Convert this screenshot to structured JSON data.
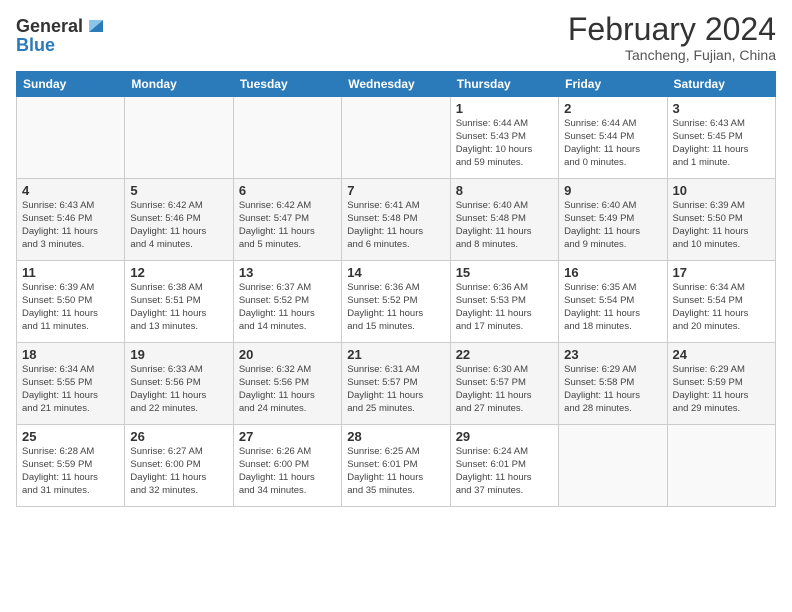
{
  "logo": {
    "general": "General",
    "blue": "Blue"
  },
  "header": {
    "title": "February 2024",
    "subtitle": "Tancheng, Fujian, China"
  },
  "weekdays": [
    "Sunday",
    "Monday",
    "Tuesday",
    "Wednesday",
    "Thursday",
    "Friday",
    "Saturday"
  ],
  "weeks": [
    [
      {
        "day": "",
        "info": ""
      },
      {
        "day": "",
        "info": ""
      },
      {
        "day": "",
        "info": ""
      },
      {
        "day": "",
        "info": ""
      },
      {
        "day": "1",
        "info": "Sunrise: 6:44 AM\nSunset: 5:43 PM\nDaylight: 10 hours\nand 59 minutes."
      },
      {
        "day": "2",
        "info": "Sunrise: 6:44 AM\nSunset: 5:44 PM\nDaylight: 11 hours\nand 0 minutes."
      },
      {
        "day": "3",
        "info": "Sunrise: 6:43 AM\nSunset: 5:45 PM\nDaylight: 11 hours\nand 1 minute."
      }
    ],
    [
      {
        "day": "4",
        "info": "Sunrise: 6:43 AM\nSunset: 5:46 PM\nDaylight: 11 hours\nand 3 minutes."
      },
      {
        "day": "5",
        "info": "Sunrise: 6:42 AM\nSunset: 5:46 PM\nDaylight: 11 hours\nand 4 minutes."
      },
      {
        "day": "6",
        "info": "Sunrise: 6:42 AM\nSunset: 5:47 PM\nDaylight: 11 hours\nand 5 minutes."
      },
      {
        "day": "7",
        "info": "Sunrise: 6:41 AM\nSunset: 5:48 PM\nDaylight: 11 hours\nand 6 minutes."
      },
      {
        "day": "8",
        "info": "Sunrise: 6:40 AM\nSunset: 5:48 PM\nDaylight: 11 hours\nand 8 minutes."
      },
      {
        "day": "9",
        "info": "Sunrise: 6:40 AM\nSunset: 5:49 PM\nDaylight: 11 hours\nand 9 minutes."
      },
      {
        "day": "10",
        "info": "Sunrise: 6:39 AM\nSunset: 5:50 PM\nDaylight: 11 hours\nand 10 minutes."
      }
    ],
    [
      {
        "day": "11",
        "info": "Sunrise: 6:39 AM\nSunset: 5:50 PM\nDaylight: 11 hours\nand 11 minutes."
      },
      {
        "day": "12",
        "info": "Sunrise: 6:38 AM\nSunset: 5:51 PM\nDaylight: 11 hours\nand 13 minutes."
      },
      {
        "day": "13",
        "info": "Sunrise: 6:37 AM\nSunset: 5:52 PM\nDaylight: 11 hours\nand 14 minutes."
      },
      {
        "day": "14",
        "info": "Sunrise: 6:36 AM\nSunset: 5:52 PM\nDaylight: 11 hours\nand 15 minutes."
      },
      {
        "day": "15",
        "info": "Sunrise: 6:36 AM\nSunset: 5:53 PM\nDaylight: 11 hours\nand 17 minutes."
      },
      {
        "day": "16",
        "info": "Sunrise: 6:35 AM\nSunset: 5:54 PM\nDaylight: 11 hours\nand 18 minutes."
      },
      {
        "day": "17",
        "info": "Sunrise: 6:34 AM\nSunset: 5:54 PM\nDaylight: 11 hours\nand 20 minutes."
      }
    ],
    [
      {
        "day": "18",
        "info": "Sunrise: 6:34 AM\nSunset: 5:55 PM\nDaylight: 11 hours\nand 21 minutes."
      },
      {
        "day": "19",
        "info": "Sunrise: 6:33 AM\nSunset: 5:56 PM\nDaylight: 11 hours\nand 22 minutes."
      },
      {
        "day": "20",
        "info": "Sunrise: 6:32 AM\nSunset: 5:56 PM\nDaylight: 11 hours\nand 24 minutes."
      },
      {
        "day": "21",
        "info": "Sunrise: 6:31 AM\nSunset: 5:57 PM\nDaylight: 11 hours\nand 25 minutes."
      },
      {
        "day": "22",
        "info": "Sunrise: 6:30 AM\nSunset: 5:57 PM\nDaylight: 11 hours\nand 27 minutes."
      },
      {
        "day": "23",
        "info": "Sunrise: 6:29 AM\nSunset: 5:58 PM\nDaylight: 11 hours\nand 28 minutes."
      },
      {
        "day": "24",
        "info": "Sunrise: 6:29 AM\nSunset: 5:59 PM\nDaylight: 11 hours\nand 29 minutes."
      }
    ],
    [
      {
        "day": "25",
        "info": "Sunrise: 6:28 AM\nSunset: 5:59 PM\nDaylight: 11 hours\nand 31 minutes."
      },
      {
        "day": "26",
        "info": "Sunrise: 6:27 AM\nSunset: 6:00 PM\nDaylight: 11 hours\nand 32 minutes."
      },
      {
        "day": "27",
        "info": "Sunrise: 6:26 AM\nSunset: 6:00 PM\nDaylight: 11 hours\nand 34 minutes."
      },
      {
        "day": "28",
        "info": "Sunrise: 6:25 AM\nSunset: 6:01 PM\nDaylight: 11 hours\nand 35 minutes."
      },
      {
        "day": "29",
        "info": "Sunrise: 6:24 AM\nSunset: 6:01 PM\nDaylight: 11 hours\nand 37 minutes."
      },
      {
        "day": "",
        "info": ""
      },
      {
        "day": "",
        "info": ""
      }
    ]
  ]
}
